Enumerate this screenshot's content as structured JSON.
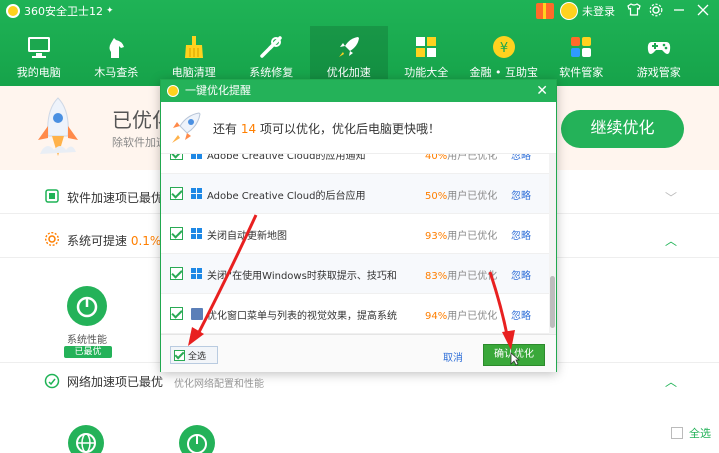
{
  "app": {
    "title": "360安全卫士12",
    "title_arrow": "✦",
    "login": "未登录"
  },
  "nav": [
    {
      "label": "我的电脑",
      "icon": "monitor-icon"
    },
    {
      "label": "木马查杀",
      "icon": "horse-icon"
    },
    {
      "label": "电脑清理",
      "icon": "broom-icon"
    },
    {
      "label": "系统修复",
      "icon": "wrench-icon"
    },
    {
      "label": "优化加速",
      "icon": "rocket-icon"
    },
    {
      "label": "功能大全",
      "icon": "grid-icon"
    },
    {
      "label": "金融 • 互助宝",
      "icon": "yen-icon"
    },
    {
      "label": "软件管家",
      "icon": "apps-icon"
    },
    {
      "label": "游戏管家",
      "icon": "gamepad-icon"
    }
  ],
  "background": {
    "status_title": "已优化",
    "status_sub": "除软件加速",
    "continue_button": "继续优化",
    "row1_text": "软件加速项已最优",
    "row2_text": "系统可提速",
    "row2_pct": "0.1%",
    "perf_label": "系统性能",
    "perf_badge": "已最优",
    "row3_text": "网络加速项已最优",
    "row3_sub": "优化网络配置和性能",
    "select_all": "全选"
  },
  "dialog": {
    "title": "一键优化提醒",
    "msg_prefix": "还有",
    "msg_count": "14",
    "msg_suffix": "项可以优化，优化后电脑更快哦！",
    "items": [
      {
        "name": "Adobe Creative Cloud的应用通知",
        "pct": "40%",
        "suffix": "用户已优化",
        "ignore": "忽略"
      },
      {
        "name": "Adobe Creative Cloud的后台应用",
        "pct": "50%",
        "suffix": "用户已优化",
        "ignore": "忽略"
      },
      {
        "name": "关闭自动更新地图",
        "pct": "93%",
        "suffix": "用户已优化",
        "ignore": "忽略"
      },
      {
        "name": "关闭“在使用Windows时获取提示、技巧和...",
        "pct": "83%",
        "suffix": "用户已优化",
        "ignore": "忽略"
      },
      {
        "name": "优化窗口菜单与列表的视觉效果，提高系统...",
        "pct": "94%",
        "suffix": "用户已优化",
        "ignore": "忽略"
      }
    ],
    "select_all": "全选",
    "cancel": "取消",
    "confirm": "确认优化"
  },
  "colors": {
    "brand_green": "#1fb356",
    "accent_orange": "#ff7f00",
    "link_blue": "#2f6fd8",
    "annotation_red": "#e82020"
  }
}
